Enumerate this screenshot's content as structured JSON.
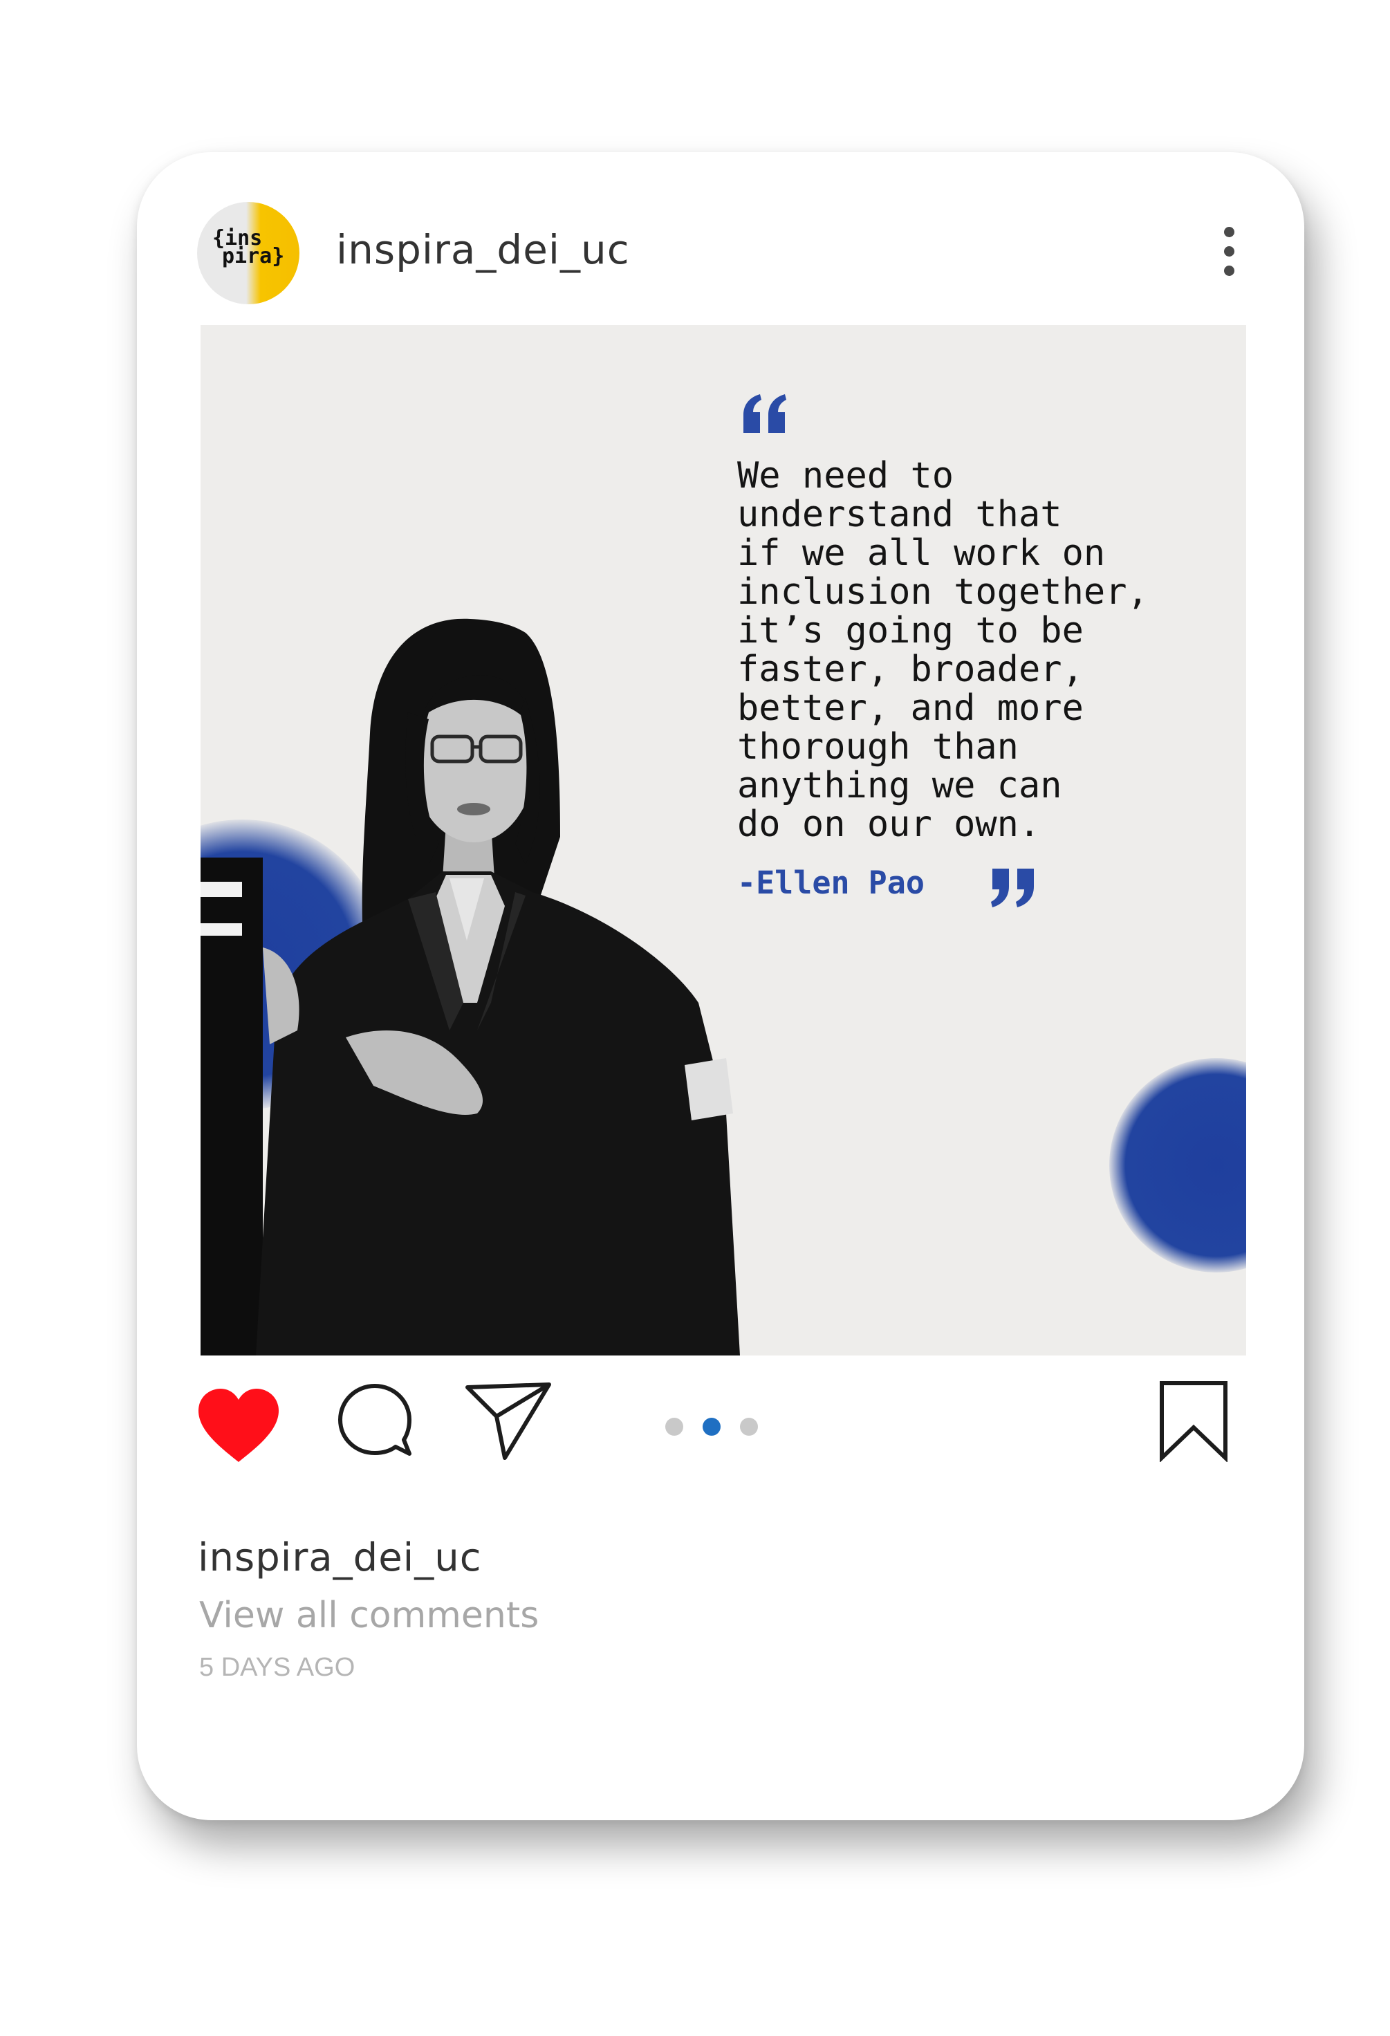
{
  "post": {
    "username": "inspira_dei_uc",
    "avatar": {
      "logo_line_1": "{ins",
      "logo_line_2": "pira}",
      "colors": [
        "#e9e9e9",
        "#f5bf00"
      ]
    },
    "menu_icon": "more-vertical-icon",
    "image": {
      "quote_lines": [
        "We need to",
        "understand that",
        "if we all work on",
        "inclusion together,",
        "it’s going to be",
        "faster, broader,",
        "better, and more",
        "thorough than",
        "anything we can",
        "do on our own."
      ],
      "author": "-Ellen Pao",
      "accent_color": "#2a4ba6",
      "background_color": "#eeedeb"
    },
    "actions": {
      "like_icon": "heart-icon",
      "like_color": "#ff0f19",
      "comment_icon": "comment-icon",
      "share_icon": "share-icon",
      "save_icon": "bookmark-icon",
      "carousel": {
        "count": 3,
        "active_index": 1,
        "active_color": "#1f6fc2"
      }
    },
    "caption": {
      "username": "inspira_dei_uc",
      "view_comments": "View all comments",
      "time_ago": "5 DAYS AGO"
    }
  }
}
